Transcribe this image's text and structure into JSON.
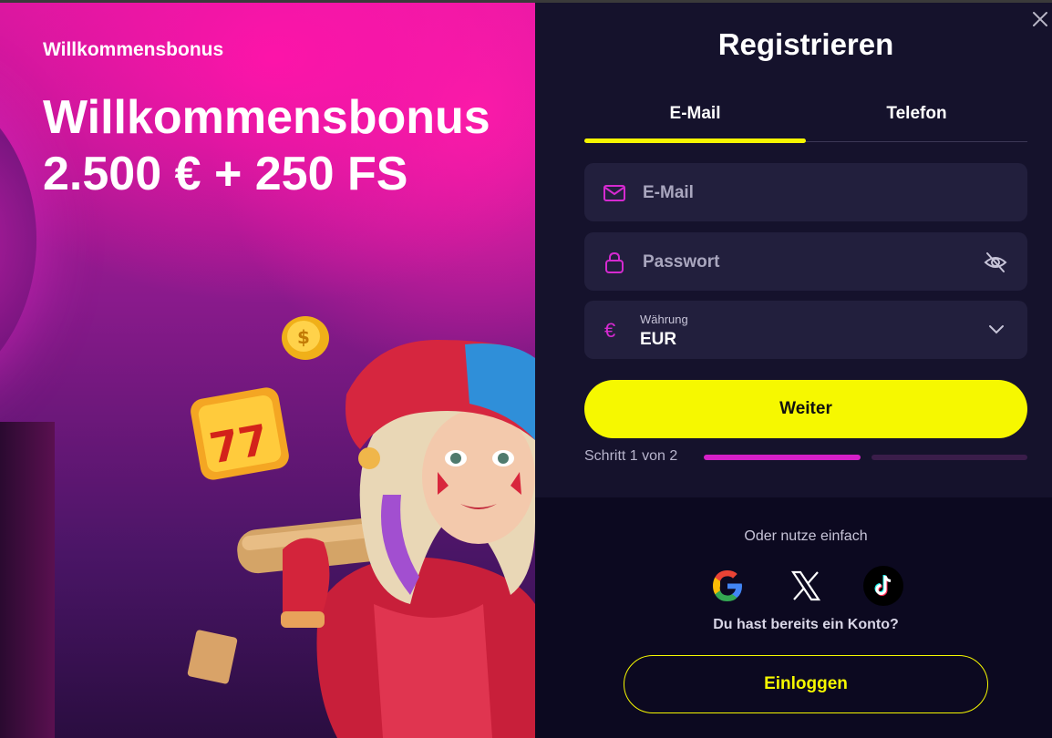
{
  "promo": {
    "label": "Willkommensbonus",
    "title_line1": "Willkommensbonus",
    "title_line2": "2.500 € + 250 FS"
  },
  "form": {
    "title": "Registrieren",
    "tabs": [
      {
        "label": "E-Mail",
        "active": true
      },
      {
        "label": "Telefon",
        "active": false
      }
    ],
    "email_placeholder": "E-Mail",
    "password_placeholder": "Passwort",
    "currency": {
      "label": "Währung",
      "symbol": "€",
      "value": "EUR"
    },
    "next_label": "Weiter",
    "step_text": "Schritt 1 von 2",
    "step_progress": 0.5
  },
  "social": {
    "prompt": "Oder nutze einfach",
    "providers": [
      "google-icon",
      "x-icon",
      "tiktok-icon"
    ],
    "account_prompt": "Du hast bereits ein Konto?",
    "login_label": "Einloggen"
  },
  "colors": {
    "accent_yellow": "#f6f800",
    "accent_pink": "#d51fc7",
    "panel_bg": "#15122c",
    "field_bg": "#221f3d"
  }
}
